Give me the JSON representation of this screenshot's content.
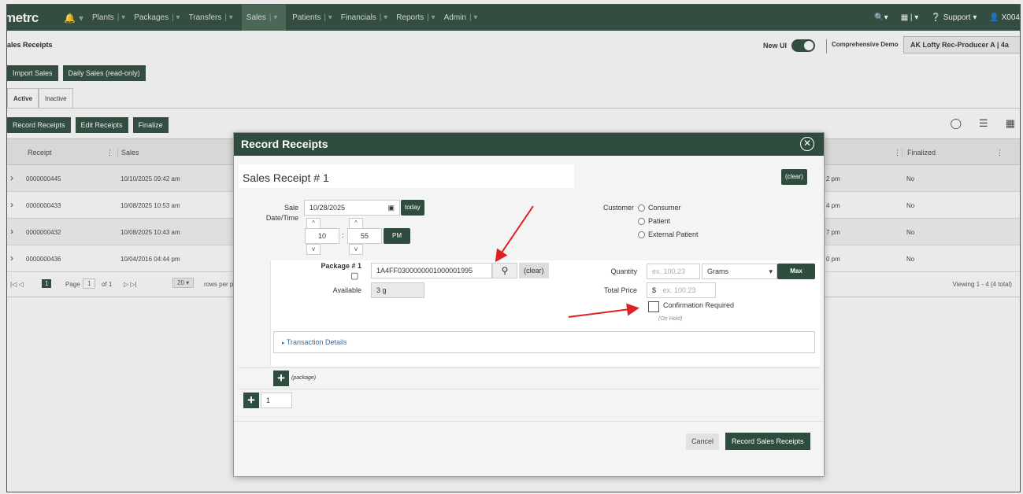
{
  "nav": {
    "logo": "metrc",
    "items": [
      "Plants",
      "Packages",
      "Transfers",
      "Sales",
      "Patients",
      "Financials",
      "Reports",
      "Admin"
    ],
    "support": "Support",
    "user": "X004"
  },
  "page": {
    "title": "ales Receipts",
    "new_ui": "New UI",
    "demo": "Comprehensive Demo",
    "facility": "AK Lofty Rec-Producer A | 4a"
  },
  "toolbar": {
    "import_sales": "Import Sales",
    "daily_sales": "Daily Sales (read-only)",
    "tab_active": "Active",
    "tab_inactive": "Inactive",
    "record_receipts": "Record Receipts",
    "edit_receipts": "Edit Receipts",
    "finalize": "Finalize"
  },
  "grid": {
    "columns": {
      "receipt": "Receipt",
      "sales": "Sales",
      "finalized": "Finalized"
    },
    "rows": [
      {
        "receipt": "0000000445",
        "sales": "10/10/2025 09:42 am",
        "time": "2 pm",
        "finalized": "No"
      },
      {
        "receipt": "0000000433",
        "sales": "10/08/2025 10:53 am",
        "time": "4 pm",
        "finalized": "No"
      },
      {
        "receipt": "0000000432",
        "sales": "10/08/2025 10:43 am",
        "time": "7 pm",
        "finalized": "No"
      },
      {
        "receipt": "0000000436",
        "sales": "10/04/2016 04:44 pm",
        "time": "0 pm",
        "finalized": "No"
      }
    ],
    "pager": {
      "page_label": "Page",
      "page": "1",
      "of": "of 1",
      "per_page": "20",
      "per_page_label": "rows per p",
      "viewing": "Viewing 1 - 4 (4 total)"
    }
  },
  "modal": {
    "title": "Record Receipts",
    "receipt_header": "Sales Receipt # 1",
    "clear": "(clear)",
    "sale_label": "Sale",
    "datetime_label": "Date/Time",
    "date": "10/28/2025",
    "today": "today",
    "hour": "10",
    "minute": "55",
    "ampm": "PM",
    "customer_label": "Customer",
    "customer_options": [
      "Consumer",
      "Patient",
      "External Patient"
    ],
    "package_label": "Package # 1",
    "package_value": "1A4FF0300000001000001995",
    "package_clear": "(clear)",
    "available_label": "Available",
    "available_value": "3 g",
    "quantity_label": "Quantity",
    "quantity_placeholder": "ex. 100.23",
    "unit": "Grams",
    "max": "Max",
    "total_price_label": "Total Price",
    "currency": "$",
    "price_placeholder": "ex. 100.23",
    "confirmation": "Confirmation Required",
    "on_hold": "(On Hold)",
    "transaction_details": "Transaction Details",
    "add_package": "(package)",
    "receipt_count": "1",
    "cancel": "Cancel",
    "record": "Record Sales Receipts"
  },
  "colors": {
    "brand": "#2f4d3e",
    "arrow": "#e02020",
    "link": "#2a6fb0"
  }
}
